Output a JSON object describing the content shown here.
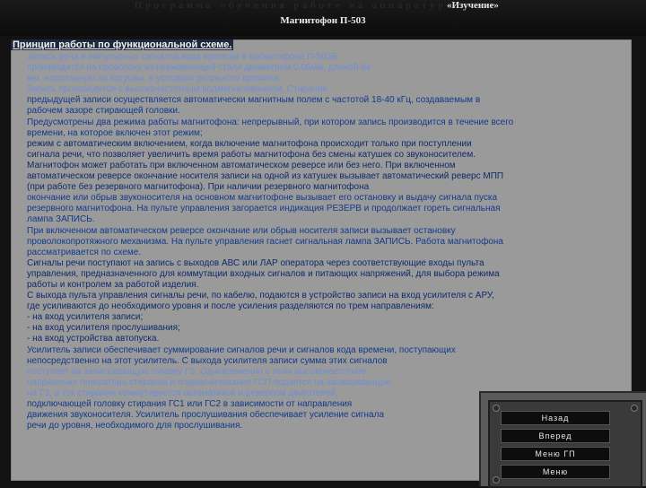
{
  "header": {
    "faded_title": "Программа обучения работе на аппаратуре",
    "mode": "«Изучение»",
    "device": "Магнитофон П-503"
  },
  "section_heading": "Принцип работы по функциональной схеме.",
  "lines": [
    "Запись речи и импульсных сигналов кода времени в магнитофоне П-503Б",
    "производится на проволоку из нержавеющей стали диаметром 0,05мм, длиной 84",
    "мм, намотанную на катушки, в условиях реального времени.",
    "Запись производится с высокочастотным подмагничиванием. Стирание",
    "предыдущей записи осуществляется автоматически магнитным полем с частотой 18-40 кГц, создаваемым в",
    "рабочем зазоре стирающей головки.",
    "Предусмотрены два режима работы магнитофона: непрерывный, при котором запись производится в течение всего",
    "времени, на которое включен этот режим;",
    "режим с автоматическим включением, когда включение магнитофона происходит только при поступлении",
    "сигнала речи, что позволяет увеличить время работы магнитофона без смены катушек со звуконосителем.",
    "Магнитофон может работать при включенном автоматическом реверсе или без него. При включенном",
    "автоматическом реверсе окончание носителя записи на одной из катушек вызывает автоматический реверс МПП",
    "(при работе без резервного магнитофона). При наличии резервного магнитофона",
    "окончание или обрыв звуконосителя на основном магнитофоне вызывает его остановку и выдачу сигнала пуска",
    "резервного магнитофона. На пульте управления загорается индикация РЕЗЕРВ и продолжает гореть сигнальная",
    "лампа ЗАПИСЬ.",
    "При включенном автоматическом реверсе окончание или обрыв носителя записи вызывает остановку",
    "проволокопротяжного механизма. На пульте управления гаснет сигнальная лампа ЗАПИСЬ. Работа магнитофона",
    "рассматривается по схеме.",
    "Сигналы речи поступают на запись с выходов АВС или ЛАР оператора через соответствующие входы пульта",
    "управления, предназначенного для коммутации входных сигналов и питающих напряжений, для выбора режима",
    "работы и контролем за работой изделия.",
    "С выхода пульта управления сигналы речи, по кабелю, подаются в устройство записи на вход усилителя с АРУ,",
    "где усиливаются до необходимого уровня и после усиления разделяются по трем направлениям:",
    "- на вход усилителя записи;",
    "- на вход усилителя прослушивания;",
    "- на вход устройства автопуска.",
    "Усилитель записи обеспечивает суммирование сигналов речи и сигналов кода времени, поступающих",
    "непосредственно на этот усилитель. С выхода усилителя записи сумма этих сигналов",
    "поступает на записывающую головку ГЗ. Одновременно с этим высокочастотное",
    "напряжение генератора стирания и подмагничивания ГСП подается на записывающую",
    "на ГЗ, а ток стирания коммутируется автоматикой и реверсом двигателей,",
    "подключающей головку стирания ГС1 или ГС2 в зависимости от направления",
    "движения звуконосителя. Усилитель прослушивания обеспечивает усиление сигнала",
    "речи до уровня, необходимого для прослушивания."
  ],
  "menu": {
    "items": [
      "Назад",
      "Вперед",
      "Меню ГП",
      "Меню"
    ]
  },
  "colors": {
    "background": "#121212",
    "panel": "#9a9a9a",
    "text": "#123a8c"
  }
}
